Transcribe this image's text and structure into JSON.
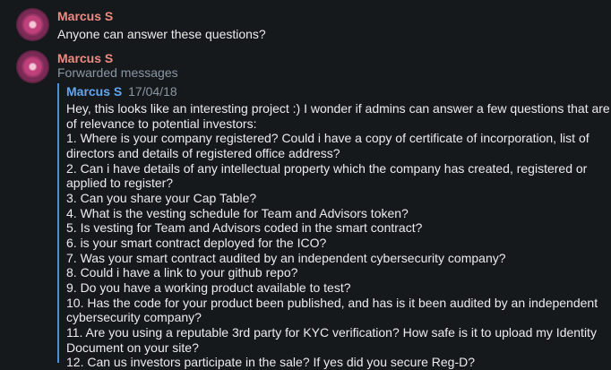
{
  "messages": [
    {
      "author": "Marcus S",
      "text": "Anyone can answer these questions?"
    },
    {
      "author": "Marcus S",
      "subtitle": "Forwarded messages",
      "forwarded": {
        "author": "Marcus S",
        "date": "17/04/18",
        "lines": [
          "Hey, this looks like an interesting project :) I wonder if admins can answer a few questions that are",
          "of relevance to potential investors:",
          "1. Where is your company registered? Could i have a copy of certificate of incorporation, list of",
          "directors and details of registered office address?",
          "2. Can i have details of any intellectual property which the company has created, registered or",
          "applied to register?",
          "3. Can you share your Cap Table?",
          "4. What is the vesting schedule for Team and Advisors token?",
          "5. Is vesting for Team and Advisors coded in the smart contract?",
          "6. is your smart contract deployed for the ICO?",
          "7. Was your smart contract audited by an independent cybersecurity company?",
          "8. Could i have a link to your github repo?",
          "9. Do you have a working product available to test?",
          "10. Has the code for your product been published, and has is it been audited by an independent",
          "cybersecurity company?",
          "11. Are you using a reputable 3rd party for KYC verification? How safe is it to upload my Identity",
          "Document on your site?",
          "12. Can us investors participate in the sale? If yes did you secure Reg-D?"
        ]
      }
    }
  ]
}
